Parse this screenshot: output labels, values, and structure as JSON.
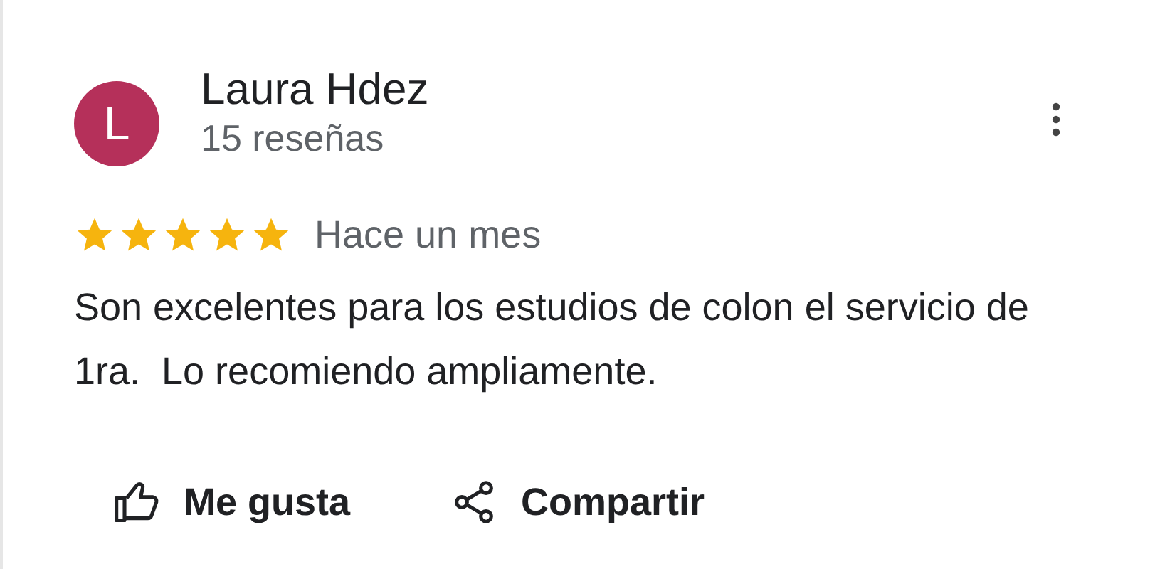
{
  "review": {
    "author": {
      "initial": "L",
      "name": "Laura Hdez",
      "meta": "15 reseñas",
      "color": "#b5305a"
    },
    "stars": 5,
    "time": "Hace un mes",
    "text": "Son excelentes para los estudios de colon el servicio de 1ra.  Lo recomiendo ampliamente.",
    "actions": [
      {
        "kind": "like",
        "label": "Me gusta"
      },
      {
        "kind": "share",
        "label": "Compartir"
      }
    ]
  }
}
